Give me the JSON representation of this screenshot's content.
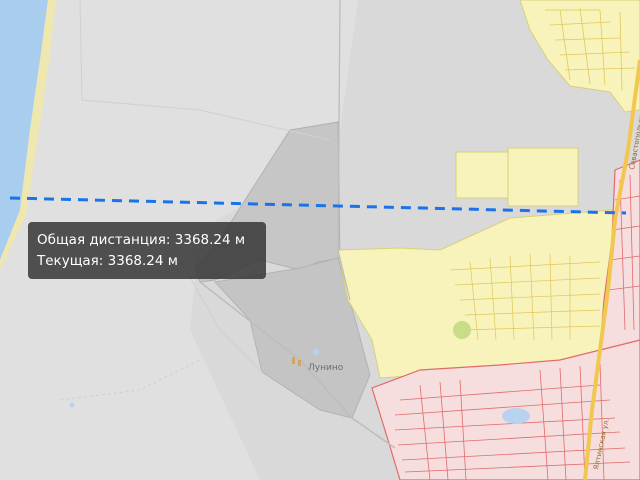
{
  "map": {
    "places": [
      {
        "name": "Лунино",
        "kind": "village"
      }
    ],
    "road_labels": [
      "Севастопольское шоссе",
      "Ялтинская ул."
    ],
    "colors": {
      "sea": "#a9cdef",
      "beach": "#efe7b0",
      "land": "#d9d9d9",
      "land_light": "#e2e2e2",
      "polygon_dark": "#c3c3c3",
      "farmland": "#f7f3ba",
      "residential": "#f6dede",
      "residential_border": "#e26a6a",
      "road_main": "#f1c74f",
      "measure_line": "#1a73e8"
    }
  },
  "measure": {
    "total_label": "Общая дистанция: 3368.24 м",
    "current_label": "Текущая: 3368.24 м",
    "distance_m": 3368.24
  }
}
